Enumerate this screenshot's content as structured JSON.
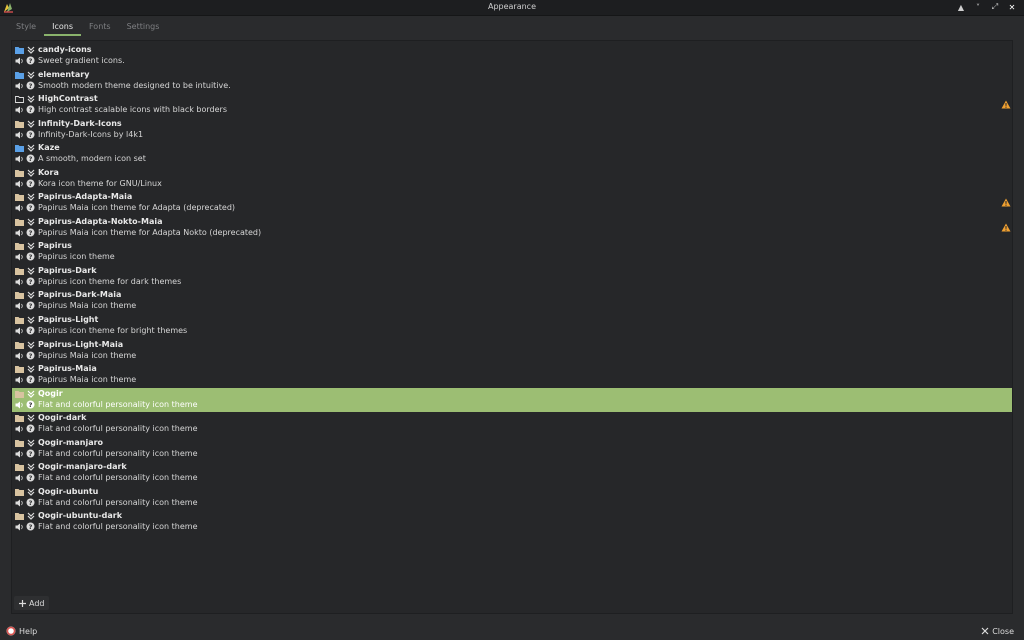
{
  "window": {
    "title": "Appearance",
    "buttons": {
      "keep_above": "▲",
      "minimize": "˅",
      "maximize": "⤢",
      "close": "✕"
    }
  },
  "tabs": [
    {
      "label": "Style",
      "active": false
    },
    {
      "label": "Icons",
      "active": true
    },
    {
      "label": "Fonts",
      "active": false
    },
    {
      "label": "Settings",
      "active": false
    }
  ],
  "icon_themes": [
    {
      "name": "candy-icons",
      "description": "Sweet gradient icons.",
      "folder": "blue",
      "warning": false,
      "selected": false
    },
    {
      "name": "elementary",
      "description": "Smooth modern theme designed to be intuitive.",
      "folder": "blue",
      "warning": false,
      "selected": false
    },
    {
      "name": "HighContrast",
      "description": "High contrast scalable icons with black borders",
      "folder": "outline",
      "warning": true,
      "selected": false
    },
    {
      "name": "Infinity-Dark-Icons",
      "description": "Infinity-Dark-Icons by l4k1",
      "folder": "beige",
      "warning": false,
      "selected": false
    },
    {
      "name": "Kaze",
      "description": "A smooth, modern icon set",
      "folder": "blue",
      "warning": false,
      "selected": false
    },
    {
      "name": "Kora",
      "description": "Kora icon theme for GNU/Linux",
      "folder": "beige",
      "warning": false,
      "selected": false
    },
    {
      "name": "Papirus-Adapta-Maia",
      "description": "Papirus Maia icon theme for Adapta (deprecated)",
      "folder": "beige",
      "warning": true,
      "selected": false
    },
    {
      "name": "Papirus-Adapta-Nokto-Maia",
      "description": "Papirus Maia icon theme for Adapta Nokto (deprecated)",
      "folder": "beige",
      "warning": true,
      "selected": false
    },
    {
      "name": "Papirus",
      "description": "Papirus icon theme",
      "folder": "beige",
      "warning": false,
      "selected": false
    },
    {
      "name": "Papirus-Dark",
      "description": "Papirus icon theme for dark themes",
      "folder": "beige",
      "warning": false,
      "selected": false
    },
    {
      "name": "Papirus-Dark-Maia",
      "description": "Papirus Maia icon theme",
      "folder": "beige",
      "warning": false,
      "selected": false
    },
    {
      "name": "Papirus-Light",
      "description": "Papirus icon theme for bright themes",
      "folder": "beige",
      "warning": false,
      "selected": false
    },
    {
      "name": "Papirus-Light-Maia",
      "description": "Papirus Maia icon theme",
      "folder": "beige",
      "warning": false,
      "selected": false
    },
    {
      "name": "Papirus-Maia",
      "description": "Papirus Maia icon theme",
      "folder": "beige",
      "warning": false,
      "selected": false
    },
    {
      "name": "Qogir",
      "description": "Flat and colorful personality icon theme",
      "folder": "beige",
      "warning": false,
      "selected": true
    },
    {
      "name": "Qogir-dark",
      "description": "Flat and colorful personality icon theme",
      "folder": "beige",
      "warning": false,
      "selected": false
    },
    {
      "name": "Qogir-manjaro",
      "description": "Flat and colorful personality icon theme",
      "folder": "beige",
      "warning": false,
      "selected": false
    },
    {
      "name": "Qogir-manjaro-dark",
      "description": "Flat and colorful personality icon theme",
      "folder": "beige",
      "warning": false,
      "selected": false
    },
    {
      "name": "Qogir-ubuntu",
      "description": "Flat and colorful personality icon theme",
      "folder": "beige",
      "warning": false,
      "selected": false
    },
    {
      "name": "Qogir-ubuntu-dark",
      "description": "Flat and colorful personality icon theme",
      "folder": "beige",
      "warning": false,
      "selected": false
    }
  ],
  "footer": {
    "add_label": "Add",
    "help_label": "Help",
    "close_label": "Close"
  },
  "colors": {
    "accent": "#8ab36c",
    "selection": "#9cbe73",
    "warning": "#f0a030",
    "folder_blue": "#5aa0e6",
    "folder_beige": "#d8c3a0"
  }
}
